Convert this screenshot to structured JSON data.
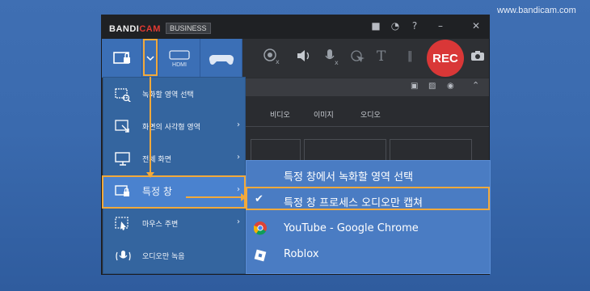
{
  "watermark": "www.bandicam.com",
  "app": {
    "brand_a": "BANDI",
    "brand_b": "CAM",
    "tier": "BUSINESS"
  },
  "titlebar": {
    "icons": [
      "folder-icon",
      "clock-icon",
      "help-icon",
      "minimize-icon",
      "close-icon"
    ]
  },
  "toolbar": {
    "hdmi_label": "HDMI",
    "rec_label": "REC",
    "tools": [
      "webcam-icon",
      "speaker-icon",
      "microphone-icon",
      "cursor-icon",
      "text-icon",
      "pause-icon",
      "camera-icon"
    ]
  },
  "tabs": [
    "비디오",
    "이미지",
    "오디오"
  ],
  "menu": {
    "items": [
      {
        "label": "녹화할 영역 선택",
        "icon": "select-area-icon",
        "has_submenu": false
      },
      {
        "label": "화면의 사각형 영역",
        "icon": "rectangle-icon",
        "has_submenu": true
      },
      {
        "label": "전체 화면",
        "icon": "monitor-icon",
        "has_submenu": true
      },
      {
        "label": "특정 창",
        "icon": "window-lock-icon",
        "has_submenu": true
      },
      {
        "label": "마우스 주변",
        "icon": "mouse-area-icon",
        "has_submenu": true
      },
      {
        "label": "오디오만 녹음",
        "icon": "audio-icon",
        "has_submenu": false
      }
    ]
  },
  "submenu": {
    "items": [
      {
        "label": "특정 창에서 녹화할 영역 선택",
        "checked": false
      },
      {
        "label": "특정 창 프로세스 오디오만 캡쳐",
        "checked": true
      },
      {
        "label": "YouTube - Google Chrome",
        "icon": "chrome-icon"
      },
      {
        "label": "Roblox",
        "icon": "roblox-icon"
      }
    ]
  },
  "colors": {
    "accent": "#3b6fb6",
    "highlight": "#f2a93b",
    "rec": "#d93737"
  }
}
